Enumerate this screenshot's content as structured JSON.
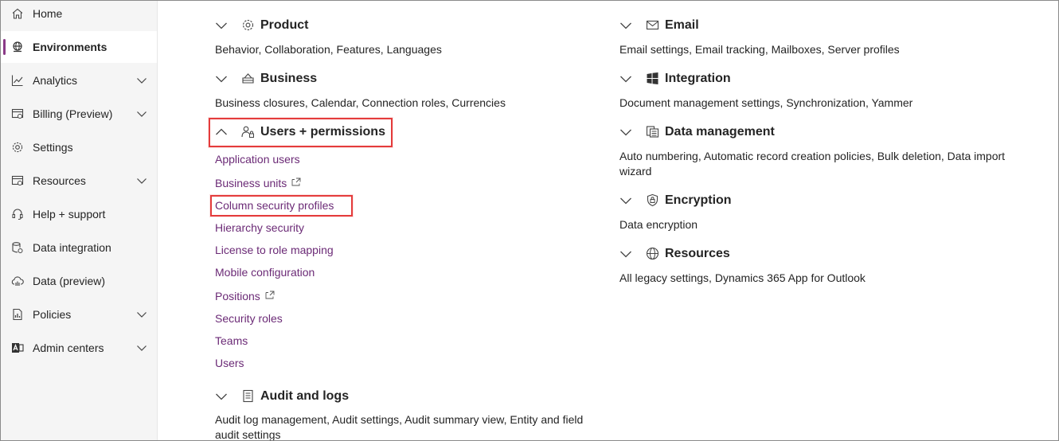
{
  "sidebar": {
    "items": [
      {
        "label": "Home",
        "icon": "home-icon",
        "expandable": false,
        "active": false
      },
      {
        "label": "Environments",
        "icon": "globe-icon",
        "expandable": false,
        "active": true
      },
      {
        "label": "Analytics",
        "icon": "analytics-icon",
        "expandable": true,
        "active": false
      },
      {
        "label": "Billing (Preview)",
        "icon": "billing-icon",
        "expandable": true,
        "active": false
      },
      {
        "label": "Settings",
        "icon": "gear-icon",
        "expandable": false,
        "active": false
      },
      {
        "label": "Resources",
        "icon": "resources-icon",
        "expandable": true,
        "active": false
      },
      {
        "label": "Help + support",
        "icon": "headset-icon",
        "expandable": false,
        "active": false
      },
      {
        "label": "Data integration",
        "icon": "data-integration-icon",
        "expandable": false,
        "active": false
      },
      {
        "label": "Data (preview)",
        "icon": "cloud-data-icon",
        "expandable": false,
        "active": false
      },
      {
        "label": "Policies",
        "icon": "policies-icon",
        "expandable": true,
        "active": false
      },
      {
        "label": "Admin centers",
        "icon": "admin-centers-icon",
        "expandable": true,
        "active": false
      }
    ]
  },
  "left_sections": {
    "product": {
      "title": "Product",
      "desc": "Behavior, Collaboration, Features, Languages"
    },
    "business": {
      "title": "Business",
      "desc": "Business closures, Calendar, Connection roles, Currencies"
    },
    "users": {
      "title": "Users + permissions",
      "links": [
        {
          "label": "Application users",
          "external": false
        },
        {
          "label": "Business units",
          "external": true
        },
        {
          "label": "Column security profiles",
          "external": false
        },
        {
          "label": "Hierarchy security",
          "external": false
        },
        {
          "label": "License to role mapping",
          "external": false
        },
        {
          "label": "Mobile configuration",
          "external": false
        },
        {
          "label": "Positions",
          "external": true
        },
        {
          "label": "Security roles",
          "external": false
        },
        {
          "label": "Teams",
          "external": false
        },
        {
          "label": "Users",
          "external": false
        }
      ]
    },
    "audit": {
      "title": "Audit and logs",
      "desc": "Audit log management, Audit settings, Audit summary view, Entity and field audit settings"
    }
  },
  "right_sections": {
    "email": {
      "title": "Email",
      "desc": "Email settings, Email tracking, Mailboxes, Server profiles"
    },
    "integration": {
      "title": "Integration",
      "desc": "Document management settings, Synchronization, Yammer"
    },
    "data_management": {
      "title": "Data management",
      "desc": "Auto numbering, Automatic record creation policies, Bulk deletion, Data import wizard"
    },
    "encryption": {
      "title": "Encryption",
      "desc": "Data encryption"
    },
    "resources": {
      "title": "Resources",
      "desc": "All legacy settings, Dynamics 365 App for Outlook"
    }
  },
  "colors": {
    "accent": "#8a3a87",
    "link": "#6b2a76",
    "highlight": "#e43c3c"
  }
}
